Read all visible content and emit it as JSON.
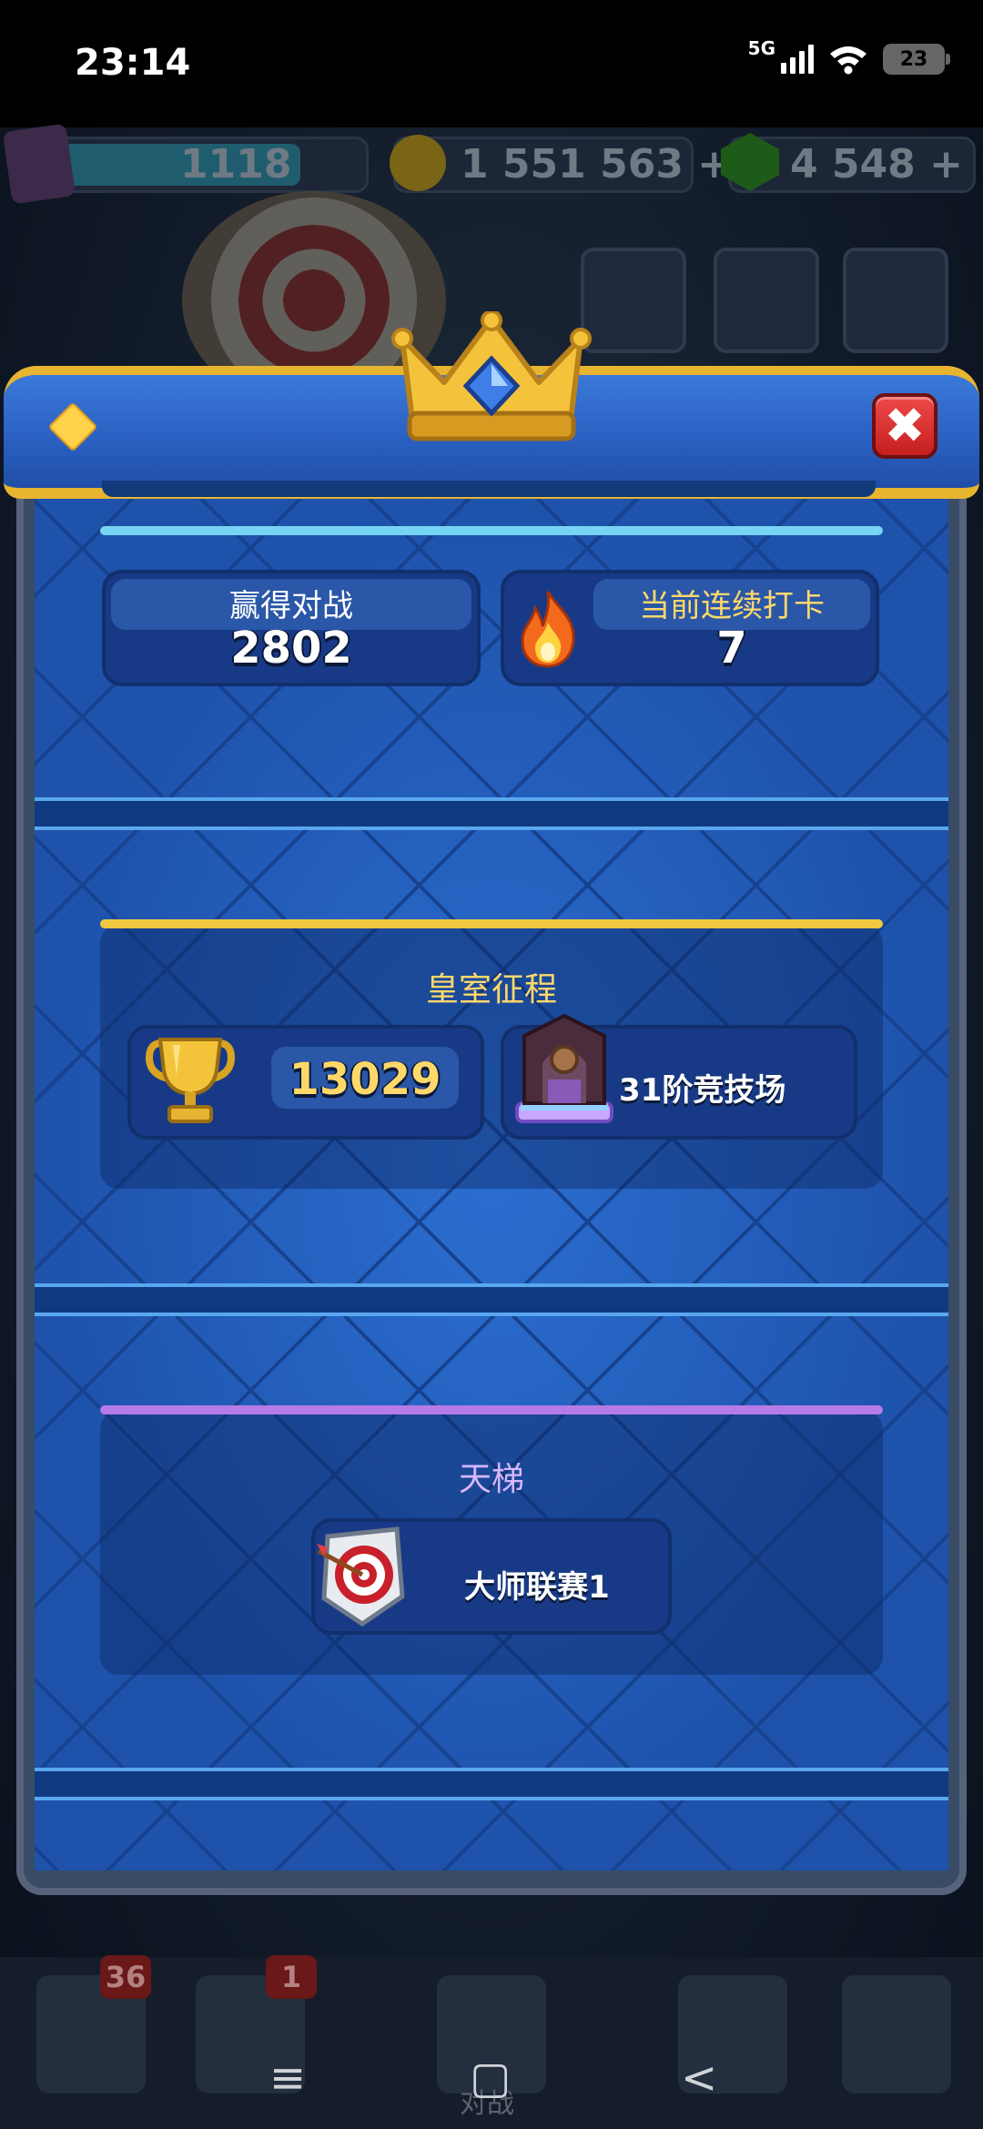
{
  "status_bar": {
    "time": "23:14",
    "network": "5G",
    "battery": "23"
  },
  "resources": {
    "exp": "1118",
    "gold": "1 551 563 +",
    "gems": "4 548 +"
  },
  "bottom_nav": {
    "cards_badge": "36",
    "deck_badge": "1",
    "battle_label": "对战"
  },
  "system_nav": {
    "menu": "≡",
    "home": "▢",
    "back": "<"
  },
  "modal": {
    "close_label": "✖",
    "stats": {
      "wins_label": "赢得对战",
      "wins_value": "2802",
      "streak_label": "当前连续打卡",
      "streak_value": "7"
    },
    "royal_road": {
      "title": "皇室征程",
      "trophies": "13029",
      "arena": "31阶竞技场"
    },
    "ladder": {
      "title": "天梯",
      "league": "大师联赛1"
    }
  },
  "colors": {
    "gold_accent": "#e8b531",
    "panel_blue": "#1f55b0",
    "close_red": "#d92b2b",
    "line_cyan": "#77d5f4",
    "line_gold": "#f0c840",
    "line_purple": "#b57be6"
  },
  "icons": {
    "crown": "crown-icon",
    "diamond": "diamond-icon",
    "flame": "flame-icon",
    "trophy": "trophy-icon",
    "arena": "arena-icon",
    "target": "target-badge-icon"
  }
}
